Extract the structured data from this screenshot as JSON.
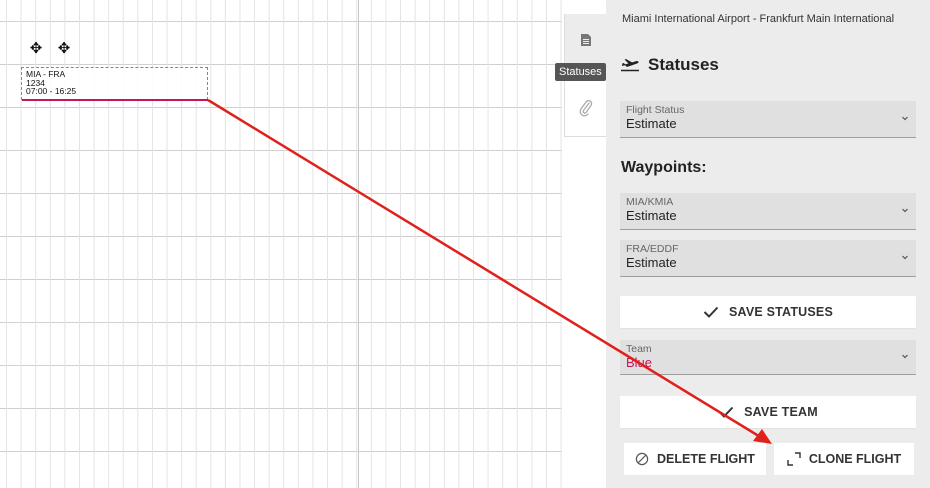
{
  "canvas": {
    "flight": {
      "route": "MIA - FRA",
      "number": "1234",
      "time": "07:00 - 16:25"
    },
    "colors": {
      "flight_bar": "#c2185b",
      "selection_border": "#5a8fc8",
      "annotation_arrow": "#e0201b"
    }
  },
  "sidebar_tabs": {
    "document_icon": "document-icon",
    "attachment_icon": "paperclip-icon",
    "tooltip": "Statuses"
  },
  "panel": {
    "route_title": "Miami International Airport - Frankfurt Main International",
    "statuses_heading": "Statuses",
    "flight_status": {
      "label": "Flight Status",
      "value": "Estimate"
    },
    "waypoints_heading": "Waypoints:",
    "waypoints": [
      {
        "label": "MIA/KMIA",
        "value": "Estimate"
      },
      {
        "label": "FRA/EDDF",
        "value": "Estimate"
      }
    ],
    "save_statuses": "SAVE STATUSES",
    "team": {
      "label": "Team",
      "value": "Blue",
      "value_color": "#c2185b"
    },
    "save_team": "SAVE TEAM",
    "delete_flight": "DELETE FLIGHT",
    "clone_flight": "CLONE FLIGHT"
  }
}
